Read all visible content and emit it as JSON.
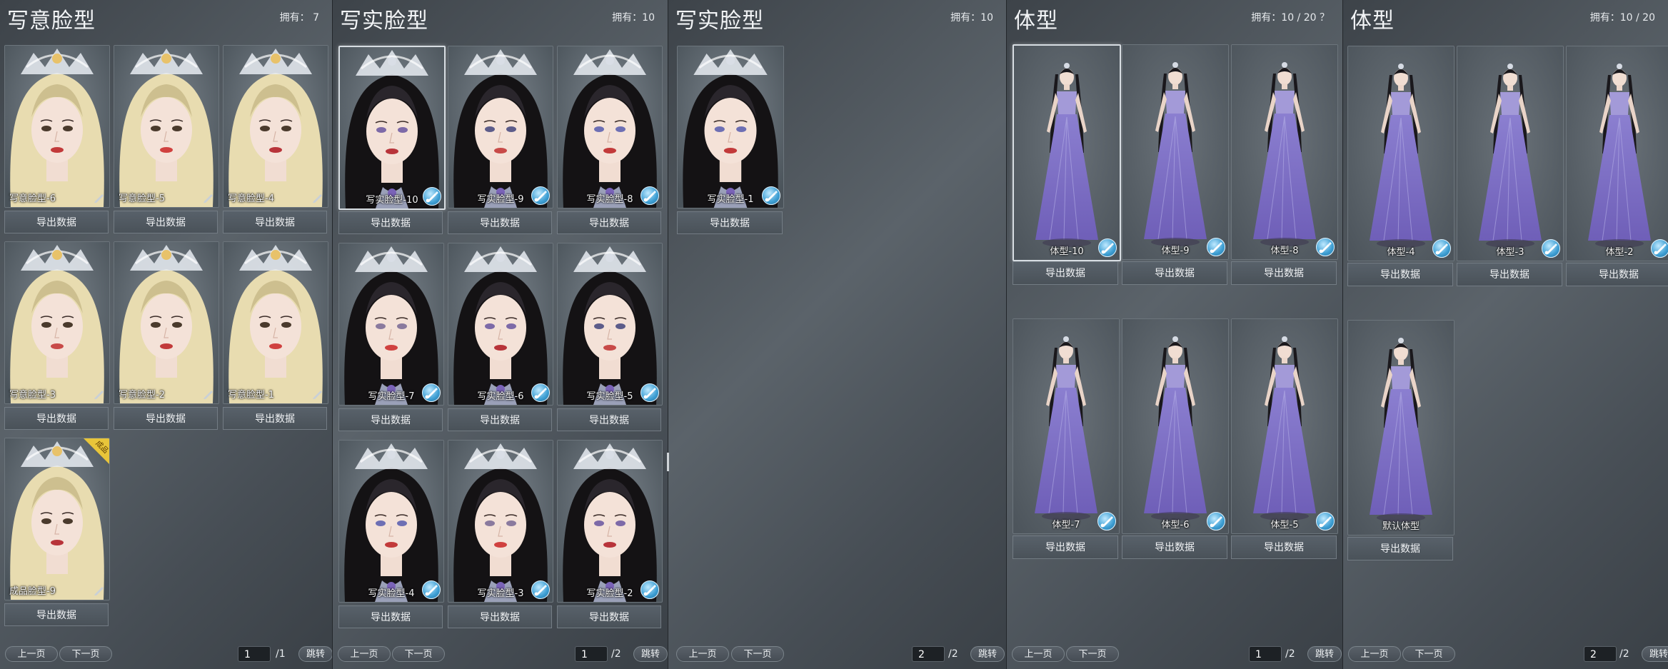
{
  "colors": {
    "accent_edit": "#3c9ed3",
    "badge_gold": "#e8c53a",
    "hair_blonde": "#e8dcb0",
    "hair_black": "#141214",
    "dress_purple": "#6f5fb8"
  },
  "panels": [
    {
      "title": "写意脸型",
      "owned": "拥有：  7",
      "kind": "face",
      "hair": "blonde",
      "export_label": "导出数据",
      "cards": [
        {
          "label": "写意脸型-6",
          "icon": "pen-icon"
        },
        {
          "label": "写意脸型-5",
          "icon": "pen-icon"
        },
        {
          "label": "写意脸型-4",
          "icon": "pen-icon"
        },
        {
          "label": "写意脸型-3",
          "icon": "pen-icon"
        },
        {
          "label": "写意脸型-2",
          "icon": "pen-icon"
        },
        {
          "label": "写意脸型-1",
          "icon": "pen-icon"
        },
        {
          "label": "成品脸型-9",
          "icon": "pen-icon",
          "badge": "成品"
        }
      ],
      "pager": {
        "prev": "上一页",
        "next": "下一页",
        "page": "1",
        "total": "/1",
        "jump": "跳转"
      }
    },
    {
      "title": "写实脸型",
      "owned": "拥有：10",
      "kind": "face",
      "hair": "black",
      "export_label": "导出数据",
      "cards": [
        {
          "label": "写实脸型-10",
          "icon": "edit-brush-icon",
          "selected": true
        },
        {
          "label": "写实脸型-9",
          "icon": "edit-brush-icon"
        },
        {
          "label": "写实脸型-8",
          "icon": "edit-brush-icon"
        },
        {
          "label": "写实脸型-7",
          "icon": "edit-brush-icon"
        },
        {
          "label": "写实脸型-6",
          "icon": "edit-brush-icon"
        },
        {
          "label": "写实脸型-5",
          "icon": "edit-brush-icon"
        },
        {
          "label": "写实脸型-4",
          "icon": "edit-brush-icon"
        },
        {
          "label": "写实脸型-3",
          "icon": "edit-brush-icon"
        },
        {
          "label": "写实脸型-2",
          "icon": "edit-brush-icon"
        }
      ],
      "pager": {
        "prev": "上一页",
        "next": "下一页",
        "page": "1",
        "total": "/2",
        "jump": "跳转"
      }
    },
    {
      "title": "写实脸型",
      "owned": "拥有：10",
      "kind": "face",
      "hair": "black",
      "export_label": "导出数据",
      "cards": [
        {
          "label": "写实脸型-1",
          "icon": "edit-brush-icon"
        }
      ],
      "pager": {
        "prev": "上一页",
        "next": "下一页",
        "page": "2",
        "total": "/2",
        "jump": "跳转"
      }
    },
    {
      "title": "体型",
      "owned": "拥有：10 / 20  ？",
      "kind": "body",
      "export_label": "导出数据",
      "cards": [
        {
          "label": "体型-10",
          "icon": "edit-brush-icon",
          "selected": true
        },
        {
          "label": "体型-9",
          "icon": "edit-brush-icon"
        },
        {
          "label": "体型-8",
          "icon": "edit-brush-icon"
        },
        {
          "label": "体型-7",
          "icon": "edit-brush-icon"
        },
        {
          "label": "体型-6",
          "icon": "edit-brush-icon"
        },
        {
          "label": "体型-5",
          "icon": "edit-brush-icon"
        }
      ],
      "pager": {
        "prev": "上一页",
        "next": "下一页",
        "page": "1",
        "total": "/2",
        "jump": "跳转"
      }
    },
    {
      "title": "体型",
      "owned": "拥有：10 / 20",
      "kind": "body",
      "export_label": "导出数据",
      "cards": [
        {
          "label": "体型-4",
          "icon": "edit-brush-icon"
        },
        {
          "label": "体型-3",
          "icon": "edit-brush-icon"
        },
        {
          "label": "体型-2",
          "icon": "edit-brush-icon"
        },
        {
          "label": "默认体型",
          "icon": ""
        }
      ],
      "pager": {
        "prev": "上一页",
        "next": "下一页",
        "page": "2",
        "total": "/2",
        "jump": "跳转"
      }
    }
  ]
}
